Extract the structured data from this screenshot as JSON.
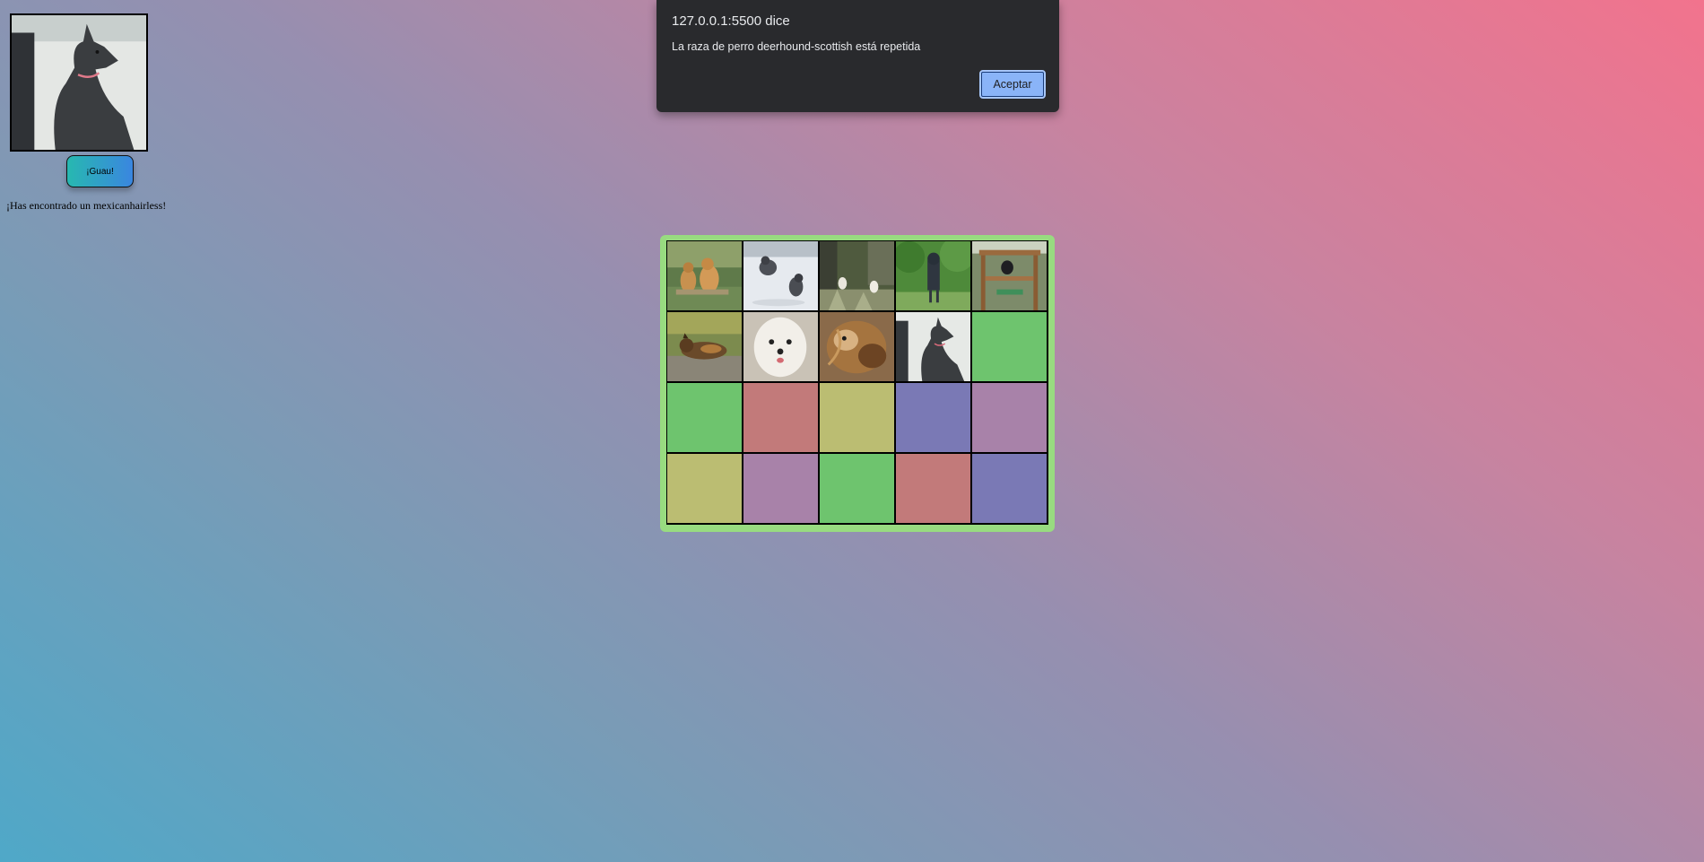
{
  "sidebar": {
    "preview_image": "mexicanhairless-dog-photo",
    "button_label": "¡Guau!",
    "found_message": "¡Has encontrado un mexicanhairless!"
  },
  "dialog": {
    "title": "127.0.0.1:5500 dice",
    "message": "La raza de perro deerhound-scottish está repetida",
    "ok_label": "Aceptar"
  },
  "board": {
    "colors": {
      "green": "#6ec46e",
      "red": "#c27a7a",
      "olive": "#bbbd72",
      "blue": "#7a79b5",
      "purple": "#a882a9",
      "frame": "#98db80"
    },
    "cells": [
      {
        "kind": "photo",
        "image": "two-afghan-hounds-on-grass"
      },
      {
        "kind": "photo",
        "image": "dogs-running-in-snow"
      },
      {
        "kind": "photo",
        "image": "small-dogs-in-garden"
      },
      {
        "kind": "photo",
        "image": "dog-standing-by-trees"
      },
      {
        "kind": "photo",
        "image": "dog-on-wooden-playground"
      },
      {
        "kind": "photo",
        "image": "german-shepherd-lying-on-rocks"
      },
      {
        "kind": "photo",
        "image": "white-fluffy-dog-face"
      },
      {
        "kind": "photo",
        "image": "brown-longhaired-dog"
      },
      {
        "kind": "photo",
        "image": "mexicanhairless-dog"
      },
      {
        "kind": "color",
        "color": "green"
      },
      {
        "kind": "color",
        "color": "green"
      },
      {
        "kind": "color",
        "color": "red"
      },
      {
        "kind": "color",
        "color": "olive"
      },
      {
        "kind": "color",
        "color": "blue"
      },
      {
        "kind": "color",
        "color": "purple"
      },
      {
        "kind": "color",
        "color": "olive"
      },
      {
        "kind": "color",
        "color": "purple"
      },
      {
        "kind": "color",
        "color": "green"
      },
      {
        "kind": "color",
        "color": "red"
      },
      {
        "kind": "color",
        "color": "blue"
      }
    ]
  }
}
